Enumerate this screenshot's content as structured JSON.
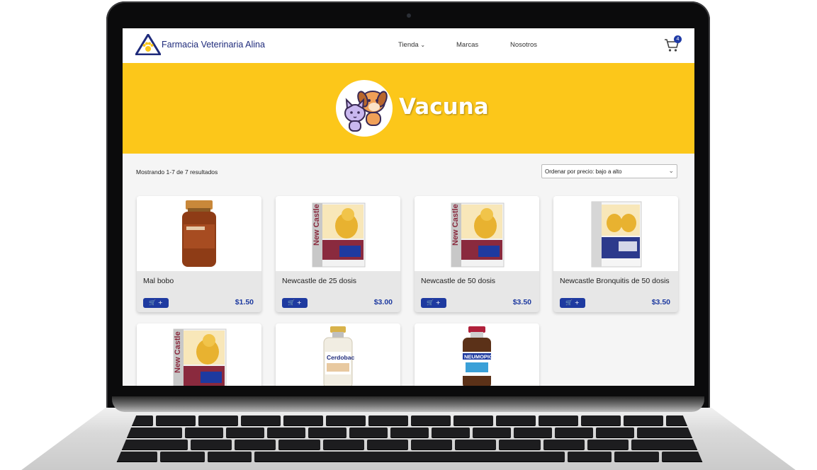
{
  "brand": {
    "name": "Farmacia Veterinaria Alina"
  },
  "nav": {
    "links": [
      "Tienda",
      "Marcas",
      "Nosotros"
    ],
    "cart_count": "4"
  },
  "hero": {
    "title": "Vacuna"
  },
  "shop": {
    "result_count": "Mostrando 1-7 de 7 resultados",
    "sort_selected": "Ordenar por precio: bajo a alto"
  },
  "products": [
    {
      "name": "Mal bobo",
      "price": "$1.50",
      "image": "bottle"
    },
    {
      "name": "Newcastle de 25 dosis",
      "price": "$3.00",
      "image": "box-newcastle"
    },
    {
      "name": "Newcastle de 50 dosis",
      "price": "$3.50",
      "image": "box-newcastle"
    },
    {
      "name": "Newcastle Bronquitis de 50 dosis",
      "price": "$3.50",
      "image": "box-bronquitis"
    },
    {
      "name": "",
      "price": "",
      "image": "box-newcastle"
    },
    {
      "name": "",
      "price": "",
      "image": "bottle-cerdobac"
    },
    {
      "name": "",
      "price": "",
      "image": "bottle-neumopig"
    }
  ],
  "add_button_label": "+",
  "colors": {
    "hero": "#fcc71a",
    "accent": "#1e3aa0",
    "brand": "#1f2b7b"
  }
}
